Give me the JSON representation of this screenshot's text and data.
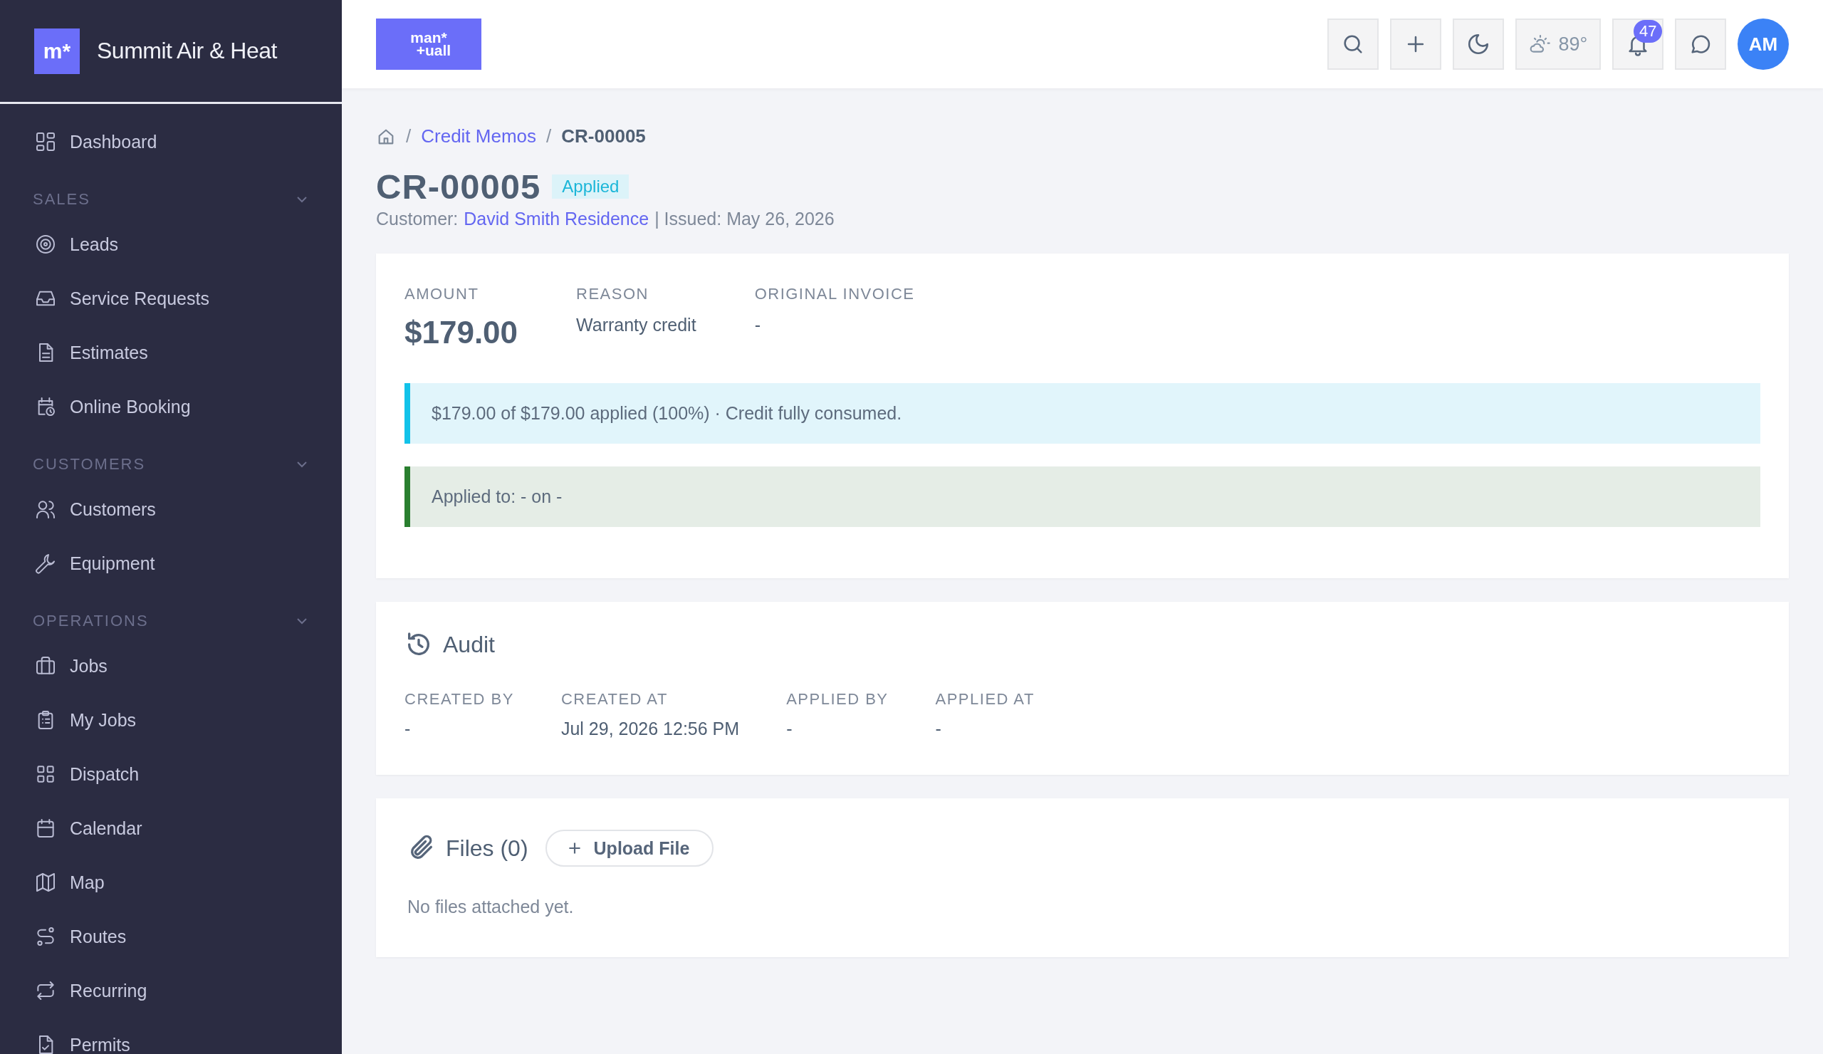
{
  "sidebar": {
    "brand_mark": "m*",
    "brand_name": "Summit Air & Heat",
    "top_item": "Dashboard",
    "sections": [
      {
        "label": "SALES",
        "expanded": true,
        "items": [
          "Leads",
          "Service Requests",
          "Estimates",
          "Online Booking"
        ]
      },
      {
        "label": "CUSTOMERS",
        "expanded": true,
        "items": [
          "Customers",
          "Equipment"
        ]
      },
      {
        "label": "OPERATIONS",
        "expanded": true,
        "items": [
          "Jobs",
          "My Jobs",
          "Dispatch",
          "Calendar",
          "Map",
          "Routes",
          "Recurring",
          "Permits"
        ]
      }
    ]
  },
  "header": {
    "logo": [
      "man*",
      "+uall"
    ],
    "weather": "89°",
    "notification_count": "47",
    "avatar": "AM"
  },
  "breadcrumb": [
    {
      "separator": "/",
      "label": "Credit Memos",
      "current": false
    },
    {
      "separator": "/",
      "label": "CR-00005",
      "current": true
    }
  ],
  "title": "CR-00005",
  "status": {
    "label": "Applied",
    "kind": "applied"
  },
  "meta": {
    "customer_label": "Customer:",
    "customer": "David Smith Residence",
    "issued": "| Issued: May 26, 2026"
  },
  "summary": [
    {
      "label": "AMOUNT",
      "value": "$179.00",
      "kind": "amount"
    },
    {
      "label": "REASON",
      "value": "Warranty credit",
      "kind": "text"
    },
    {
      "label": "ORIGINAL INVOICE",
      "value": "-",
      "kind": "text"
    }
  ],
  "alerts": [
    {
      "kind": "info",
      "text": "$179.00 of $179.00 applied (100%) · Credit fully consumed."
    },
    {
      "kind": "success",
      "text": "Applied to: - on -"
    }
  ],
  "audit": {
    "title": "Audit",
    "fields": [
      {
        "label": "CREATED BY",
        "value": "-"
      },
      {
        "label": "CREATED AT",
        "value": "Jul 29, 2026 12:56 PM"
      },
      {
        "label": "APPLIED BY",
        "value": "-"
      },
      {
        "label": "APPLIED AT",
        "value": "-"
      }
    ]
  },
  "files": {
    "title": "Files (0)",
    "upload_button": "Upload File",
    "empty_text": "No files attached yet."
  }
}
